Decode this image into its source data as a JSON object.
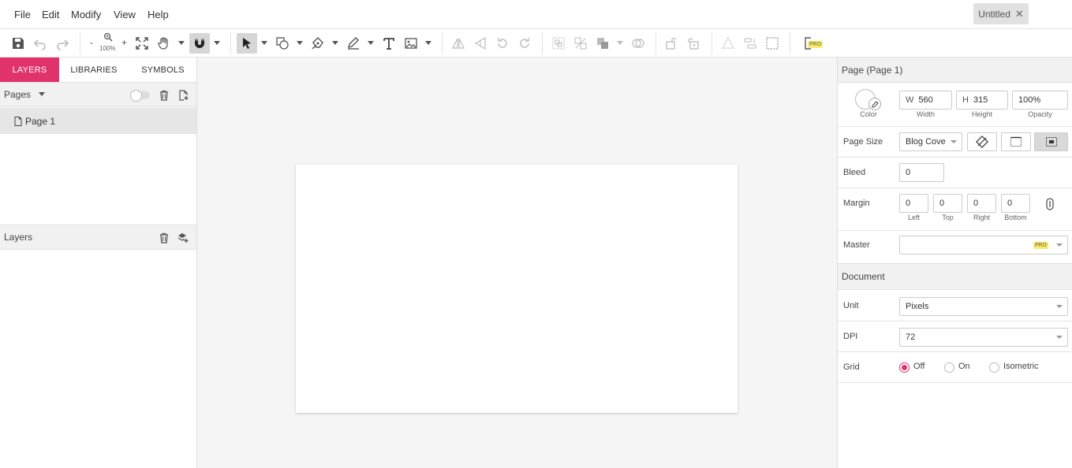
{
  "menu": {
    "items": [
      "File",
      "Edit",
      "Modify",
      "View",
      "Help"
    ]
  },
  "document_tab": {
    "label": "Untitled",
    "close": "✕"
  },
  "toolbar": {
    "zoom_minus": "-",
    "zoom_plus": "+",
    "zoom_level": "100%",
    "pro_badge": "PRO"
  },
  "left_panel": {
    "tabs": [
      "LAYERS",
      "LIBRARIES",
      "SYMBOLS"
    ],
    "pages_header": "Pages",
    "pages": [
      "Page 1"
    ],
    "layers_header": "Layers"
  },
  "right_panel": {
    "page_header": "Page (Page 1)",
    "color_caption": "Color",
    "width_prefix": "W",
    "width_value": "560",
    "width_caption": "Width",
    "height_prefix": "H",
    "height_value": "315",
    "height_caption": "Height",
    "opacity_value": "100%",
    "opacity_caption": "Opacity",
    "page_size_label": "Page Size",
    "page_size_value": "Blog Cove",
    "bleed_label": "Bleed",
    "bleed_value": "0",
    "margin_label": "Margin",
    "margin_left": "0",
    "margin_top": "0",
    "margin_right": "0",
    "margin_bottom": "0",
    "margin_left_caption": "Left",
    "margin_top_caption": "Top",
    "margin_right_caption": "Right",
    "margin_bottom_caption": "Bottom",
    "master_label": "Master",
    "master_pro_badge": "PRO",
    "document_header": "Document",
    "unit_label": "Unit",
    "unit_value": "Pixels",
    "dpi_label": "DPI",
    "dpi_value": "72",
    "grid_label": "Grid",
    "grid_options": [
      "Off",
      "On",
      "Isometric"
    ],
    "grid_selected": "Off"
  },
  "colors": {
    "accent": "#e0336b",
    "pro_badge_bg": "#f5ec7a",
    "canvas_bg": "#f5f5f5"
  }
}
